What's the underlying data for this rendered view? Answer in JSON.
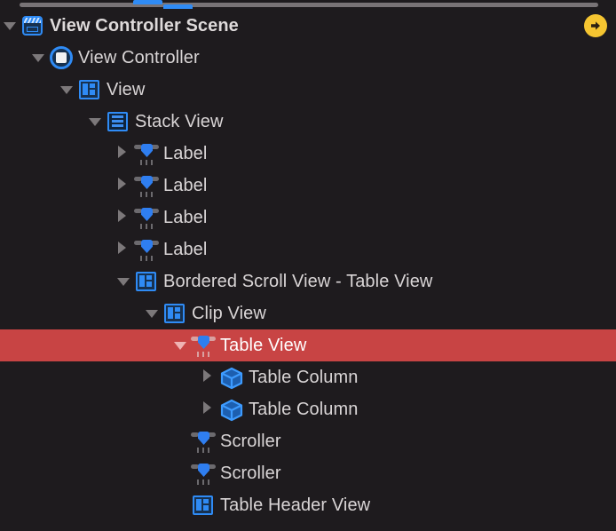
{
  "window": {
    "title": "View Controller Scene",
    "panel_name": "document-outline",
    "background_color": "#1e1b1e",
    "selection_color": "#c84444",
    "accent_color": "#2f8bf5",
    "text_color": "#d9d5d6",
    "badge_color": "#f5c531"
  },
  "scrollbar": {
    "orientation": "horizontal",
    "thumb_color": "#787376"
  },
  "jump_badge": {
    "name": "scene-jump-arrow",
    "icon": "arrow-right-circle-icon",
    "color": "#f5c531"
  },
  "outline": {
    "rows": [
      {
        "label": "View Controller Scene",
        "indent": 0,
        "twisty": "down",
        "icon": "scene-icon",
        "selected": false,
        "bold": true
      },
      {
        "label": "View Controller",
        "indent": 1,
        "twisty": "down",
        "icon": "view-controller-icon",
        "selected": false,
        "bold": false
      },
      {
        "label": "View",
        "indent": 2,
        "twisty": "down",
        "icon": "view-icon",
        "selected": false,
        "bold": false
      },
      {
        "label": "Stack View",
        "indent": 3,
        "twisty": "down",
        "icon": "stack-view-icon",
        "selected": false,
        "bold": false
      },
      {
        "label": "Label",
        "indent": 4,
        "twisty": "right",
        "icon": "label-control-icon",
        "selected": false,
        "bold": false
      },
      {
        "label": "Label",
        "indent": 4,
        "twisty": "right",
        "icon": "label-control-icon",
        "selected": false,
        "bold": false
      },
      {
        "label": "Label",
        "indent": 4,
        "twisty": "right",
        "icon": "label-control-icon",
        "selected": false,
        "bold": false
      },
      {
        "label": "Label",
        "indent": 4,
        "twisty": "right",
        "icon": "label-control-icon",
        "selected": false,
        "bold": false
      },
      {
        "label": "Bordered Scroll View - Table View",
        "indent": 4,
        "twisty": "down",
        "icon": "view-icon",
        "selected": false,
        "bold": false
      },
      {
        "label": "Clip View",
        "indent": 5,
        "twisty": "down",
        "icon": "view-icon",
        "selected": false,
        "bold": false
      },
      {
        "label": "Table View",
        "indent": 6,
        "twisty": "down",
        "icon": "table-view-icon",
        "selected": true,
        "bold": false
      },
      {
        "label": "Table Column",
        "indent": 7,
        "twisty": "right",
        "icon": "table-column-icon",
        "selected": false,
        "bold": false
      },
      {
        "label": "Table Column",
        "indent": 7,
        "twisty": "right",
        "icon": "table-column-icon",
        "selected": false,
        "bold": false
      },
      {
        "label": "Scroller",
        "indent": 6,
        "twisty": "none",
        "icon": "scroller-icon",
        "selected": false,
        "bold": false
      },
      {
        "label": "Scroller",
        "indent": 6,
        "twisty": "none",
        "icon": "scroller-icon",
        "selected": false,
        "bold": false
      },
      {
        "label": "Table Header View",
        "indent": 6,
        "twisty": "none",
        "icon": "view-icon",
        "selected": false,
        "bold": false
      }
    ]
  }
}
